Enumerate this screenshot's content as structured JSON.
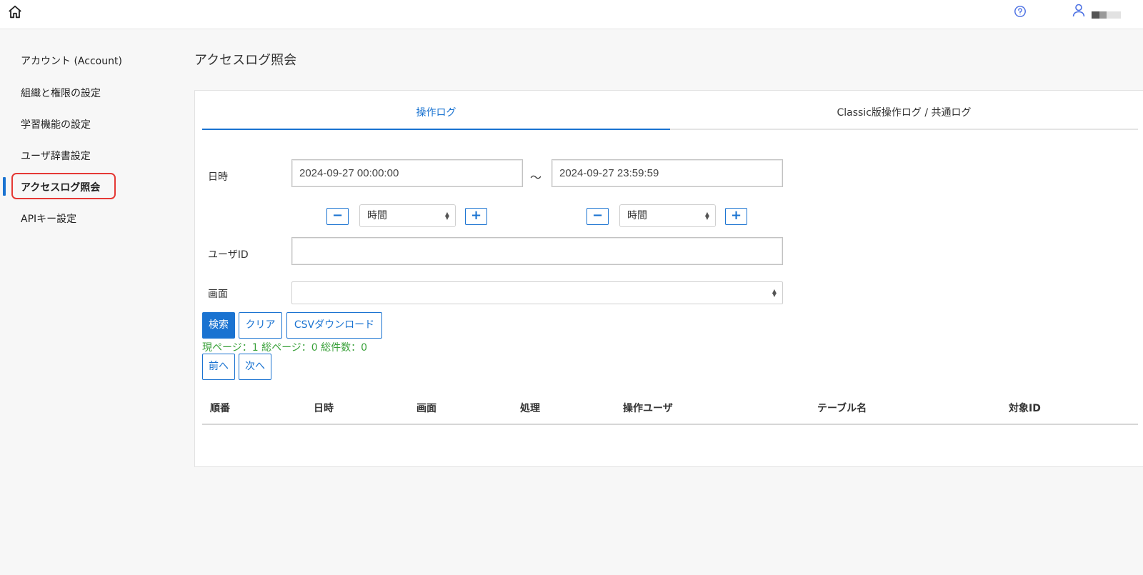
{
  "header": {
    "home_icon": "home-icon",
    "help_icon": "help-circle-icon",
    "user_icon": "user-icon"
  },
  "sidebar": {
    "items": [
      {
        "label": "アカウント (Account)"
      },
      {
        "label": "組織と権限の設定"
      },
      {
        "label": "学習機能の設定"
      },
      {
        "label": "ユーザ辞書設定"
      },
      {
        "label": "アクセスログ照会",
        "active": true
      },
      {
        "label": "APIキー設定"
      }
    ]
  },
  "main": {
    "title": "アクセスログ照会",
    "tabs": [
      {
        "label": "操作ログ",
        "active": true
      },
      {
        "label": "Classic版操作ログ / 共通ログ"
      }
    ],
    "form": {
      "datetime_label": "日時",
      "from_value": "2024-09-27 00:00:00",
      "tilde": "～",
      "to_value": "2024-09-27 23:59:59",
      "minus_label": "−",
      "plus_label": "+",
      "unit_from": "時間",
      "unit_to": "時間",
      "userid_label": "ユーザID",
      "userid_value": "",
      "screen_label": "画面",
      "screen_value": ""
    },
    "buttons": {
      "search": "検索",
      "clear": "クリア",
      "csv": "CSVダウンロード",
      "prev": "前へ",
      "next": "次へ"
    },
    "pager_info": "現ページ：1 総ページ：0 総件数：0",
    "table": {
      "columns": [
        "順番",
        "日時",
        "画面",
        "処理",
        "操作ユーザ",
        "テーブル名",
        "対象ID"
      ],
      "rows": []
    }
  },
  "colors": {
    "accent": "#1a73d1",
    "highlight_outline": "#e53935",
    "pager_text": "#3aa13a"
  }
}
